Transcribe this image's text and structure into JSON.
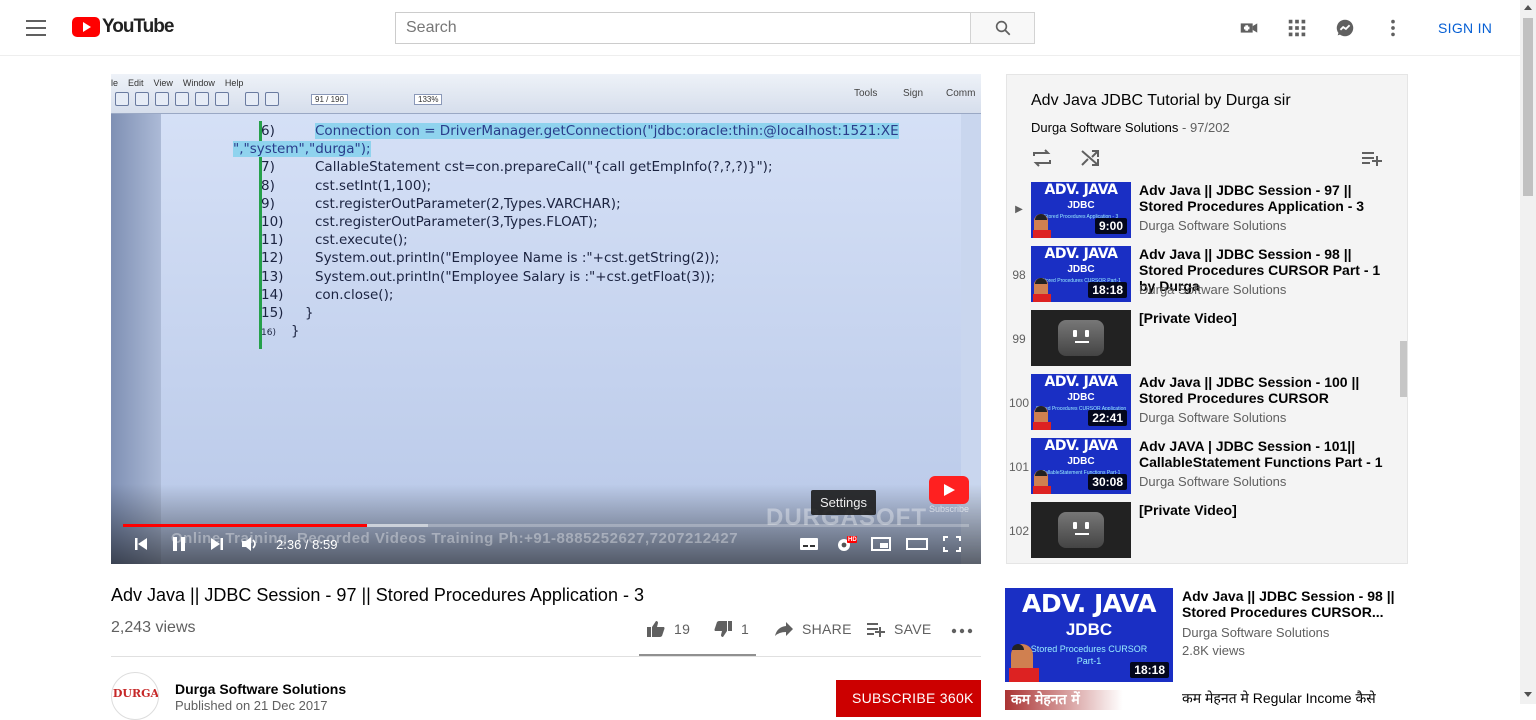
{
  "header": {
    "logo_text": "YouTube",
    "search_placeholder": "Search",
    "sign_in": "SIGN IN"
  },
  "player": {
    "pdf_menu": [
      "le",
      "Edit",
      "View",
      "Window",
      "Help"
    ],
    "pdf_page": "91 / 190",
    "pdf_zoom": "133%",
    "pdf_right": [
      "Tools",
      "Sign",
      "Comm"
    ],
    "code_lines": [
      {
        "num": "6)",
        "text": "Connection con = DriverManager.getConnection(\"jdbc:oracle:thin:@localhost:1521:XE",
        "highlight": true
      },
      {
        "num": "",
        "text": "\",\"system\",\"durga\");",
        "highlight": true,
        "cont": true
      },
      {
        "num": "7)",
        "text": "CallableStatement cst=con.prepareCall(\"{call getEmpInfo(?,?,?)}\");"
      },
      {
        "num": "8)",
        "text": "cst.setInt(1,100);"
      },
      {
        "num": "9)",
        "text": "cst.registerOutParameter(2,Types.VARCHAR);"
      },
      {
        "num": "10)",
        "text": "cst.registerOutParameter(3,Types.FLOAT);"
      },
      {
        "num": "11)",
        "text": "cst.execute();"
      },
      {
        "num": "12)",
        "text": "System.out.println(\"Employee Name is :\"+cst.getString(2));"
      },
      {
        "num": "13)",
        "text": "System.out.println(\"Employee Salary is :\"+cst.getFloat(3));"
      },
      {
        "num": "14)",
        "text": "con.close();"
      },
      {
        "num": "15)",
        "text": "}"
      },
      {
        "num": "16)",
        "text": "}"
      }
    ],
    "watermark": "Online Training, Recorded Videos Training Ph:+91-8885252627,7207212427",
    "brand_watermark": "DURGASOFT",
    "subscribe_watermark": "Subscribe",
    "time": "2:36 / 8:59",
    "progress_played": 0.289,
    "progress_loaded": 0.36,
    "tooltip": "Settings",
    "hd_badge": "HD"
  },
  "video": {
    "title": "Adv Java || JDBC Session - 97 || Stored Procedures Application - 3",
    "views": "2,243 views",
    "likes": "19",
    "dislikes": "1",
    "share": "SHARE",
    "save": "SAVE"
  },
  "owner": {
    "avatar_text": "DURGA",
    "name": "Durga Software Solutions",
    "published": "Published on 21 Dec 2017",
    "subscribe": "SUBSCRIBE 360K"
  },
  "playlist": {
    "title": "Adv Java JDBC Tutorial by Durga sir",
    "channel": "Durga Software Solutions",
    "position": " - 97/202",
    "items": [
      {
        "index": "▶",
        "title": "Adv Java || JDBC Session - 97 || Stored Procedures Application - 3",
        "channel": "Durga Software Solutions",
        "duration": "9:00",
        "thumb": "java",
        "thumb_line1": "ADV. JAVA",
        "thumb_line2": "JDBC",
        "thumb_line3": "Stored Procedures Application - 3"
      },
      {
        "index": "98",
        "title": "Adv Java || JDBC Session - 98 || Stored Procedures CURSOR Part - 1 by Durga",
        "channel": "Durga Software Solutions",
        "duration": "18:18",
        "thumb": "java",
        "thumb_line1": "ADV. JAVA",
        "thumb_line2": "JDBC",
        "thumb_line3": "Stored Procedures CURSOR Part-1"
      },
      {
        "index": "99",
        "title": "[Private Video]",
        "channel": "",
        "duration": "",
        "thumb": "private"
      },
      {
        "index": "100",
        "title": "Adv Java || JDBC Session - 100 || Stored Procedures CURSOR",
        "channel": "Durga Software Solutions",
        "duration": "22:41",
        "thumb": "java",
        "thumb_line1": "ADV. JAVA",
        "thumb_line2": "JDBC",
        "thumb_line3": "Stored Procedures CURSOR Application"
      },
      {
        "index": "101",
        "title": "Adv JAVA | JDBC Session - 101|| CallableStatement Functions Part - 1",
        "channel": "Durga Software Solutions",
        "duration": "30:08",
        "thumb": "java",
        "thumb_line1": "ADV. JAVA",
        "thumb_line2": "JDBC",
        "thumb_line3": "CallableStatement Functions Part-1"
      },
      {
        "index": "102",
        "title": "[Private Video]",
        "channel": "",
        "duration": "",
        "thumb": "private"
      }
    ]
  },
  "recommendations": [
    {
      "title": "Adv Java || JDBC Session - 98 || Stored Procedures CURSOR...",
      "channel": "Durga Software Solutions",
      "views": "2.8K views",
      "duration": "18:18",
      "thumb_line1": "ADV. JAVA",
      "thumb_line2": "JDBC",
      "thumb_line3": "Stored Procedures CURSOR",
      "thumb_line4": "Part-1"
    },
    {
      "title": "कम मेहनत मे Regular Income कैसे",
      "thumb_text": "कम मेहनत में"
    }
  ],
  "colors": {
    "brand_red": "#ff0000",
    "subscribe_red": "#cc0000",
    "link_blue": "#065fd4",
    "progress_red": "#ff0000",
    "code_highlight": "#8fd3ee"
  },
  "icons": {
    "menu": "hamburger-icon",
    "search": "search-icon",
    "upload": "video-camera-icon",
    "apps": "apps-grid-icon",
    "messages": "messages-icon",
    "more": "more-vert-icon"
  }
}
